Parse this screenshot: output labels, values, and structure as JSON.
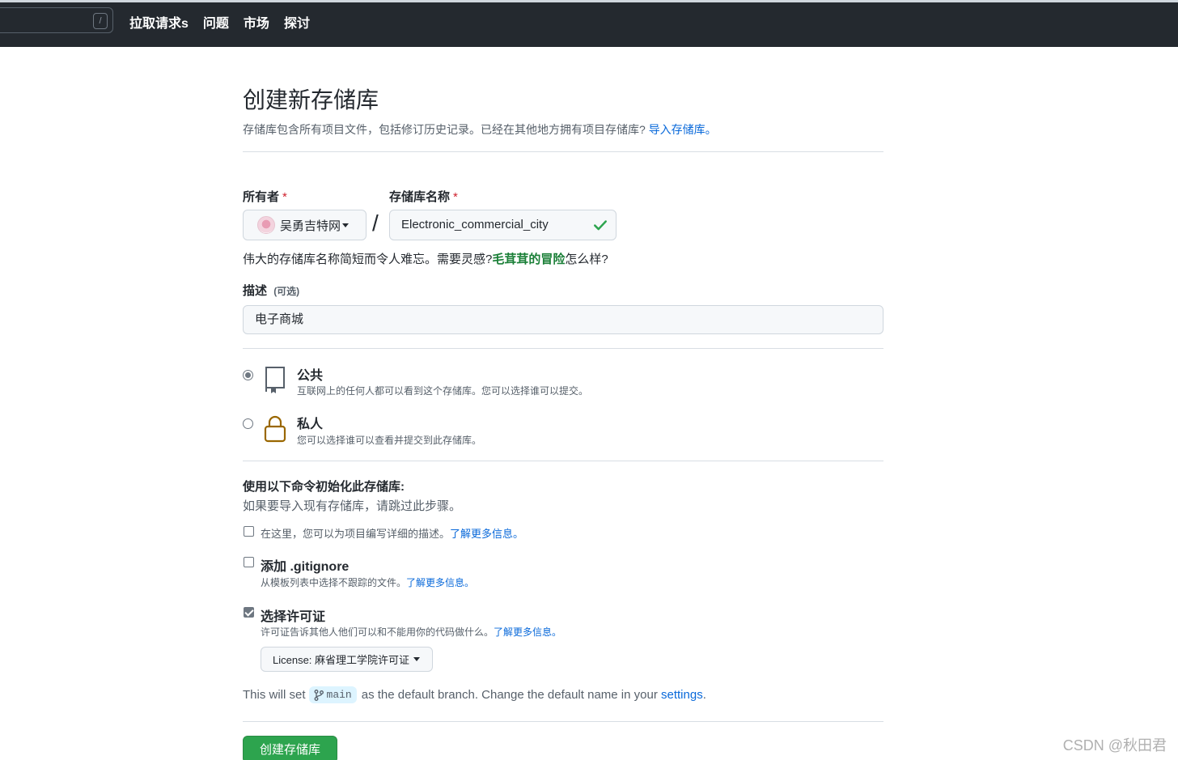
{
  "topbar": {
    "search_shortcut": "/",
    "nav": [
      "拉取请求s",
      "问题",
      "市场",
      "探讨"
    ]
  },
  "page": {
    "title": "创建新存储库",
    "subtitle": "存储库包含所有项目文件，包括修订历史记录。已经在其他地方拥有项目存储库?",
    "import_link": "导入存储库。"
  },
  "owner": {
    "label": "所有者",
    "required_mark": "*",
    "value": "吴勇吉特网"
  },
  "repo_name": {
    "label": "存储库名称",
    "required_mark": "*",
    "value": "Electronic_commercial_city",
    "separator": "/"
  },
  "name_hint": {
    "prefix": "伟大的存储库名称简短而令人难忘。需要灵感?",
    "suggestion": "毛茸茸的冒险",
    "suffix": "怎么样?"
  },
  "description": {
    "label": "描述",
    "optional": "(可选)",
    "value": "电子商城"
  },
  "visibility": {
    "public": {
      "title": "公共",
      "desc": "互联网上的任何人都可以看到这个存储库。您可以选择谁可以提交。",
      "selected": true
    },
    "private": {
      "title": "私人",
      "desc": "您可以选择谁可以查看并提交到此存储库。",
      "selected": false
    }
  },
  "init": {
    "heading": "使用以下命令初始化此存储库:",
    "subheading": "如果要导入现有存储库，请跳过此步骤。",
    "readme": {
      "text": "在这里，您可以为项目编写详细的描述。",
      "link": "了解更多信息。",
      "checked": false
    },
    "gitignore": {
      "title": "添加 .gitignore",
      "desc": "从模板列表中选择不跟踪的文件。",
      "link": "了解更多信息。",
      "checked": false
    },
    "license": {
      "title": "选择许可证",
      "desc": "许可证告诉其他人他们可以和不能用你的代码做什么。",
      "link": "了解更多信息。",
      "checked": true,
      "select_label": "License: 麻省理工学院许可证"
    }
  },
  "branch": {
    "prefix": "This will set",
    "name": "main",
    "middle": "as the default branch. Change the default name in your",
    "settings_link": "settings",
    "suffix": "."
  },
  "submit_label": "创建存储库",
  "watermark": "CSDN @秋田君",
  "colors": {
    "topbar": "#24292f",
    "primary_button": "#2da44e",
    "link": "#0969da",
    "required": "#cf222e",
    "lock_icon": "#9a6700"
  }
}
